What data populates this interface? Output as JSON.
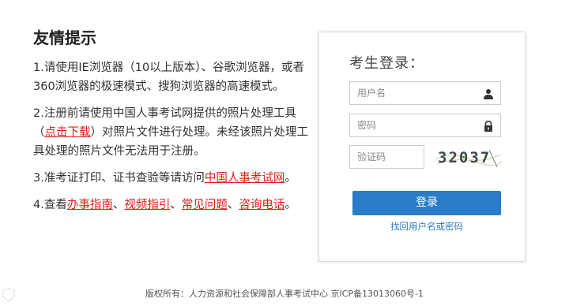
{
  "notice": {
    "title": "友情提示",
    "item1": "1.请使用IE浏览器（10以上版本）、谷歌浏览器，或者360浏览器的极速模式、搜狗浏览器的高速模式。",
    "item2": {
      "part1": "2.注册前请使用中国人事考试网提供的照片处理工具（",
      "link": "点击下载",
      "part2": "）对照片文件进行处理。未经该照片处理工具处理的照片文件无法用于注册。"
    },
    "item3": {
      "part1": "3.准考证打印、证书查验等请访问",
      "link": "中国人事考试网",
      "part2": "。"
    },
    "item4": {
      "prefix": "4.查看",
      "link1": "办事指南",
      "sep1": "、",
      "link2": "视频指引",
      "sep2": "、",
      "link3": "常见问题",
      "sep3": "、",
      "link4": "咨询电话",
      "suffix": "。"
    }
  },
  "login": {
    "title": "考生登录：",
    "username_placeholder": "用户名",
    "password_placeholder": "密码",
    "captcha_placeholder": "验证码",
    "captcha_text": "32037",
    "submit_label": "登录",
    "recover_label": "找回用户名或密码",
    "icons": {
      "username": "user-icon",
      "password": "lock-icon"
    },
    "accent_color": "#2b7cc7"
  },
  "footer": {
    "text": "版权所有：人力资源和社会保障部人事考试中心 京ICP备13013060号-1"
  },
  "colors": {
    "link_red": "#e0201a",
    "button_blue": "#2b7cc7"
  }
}
